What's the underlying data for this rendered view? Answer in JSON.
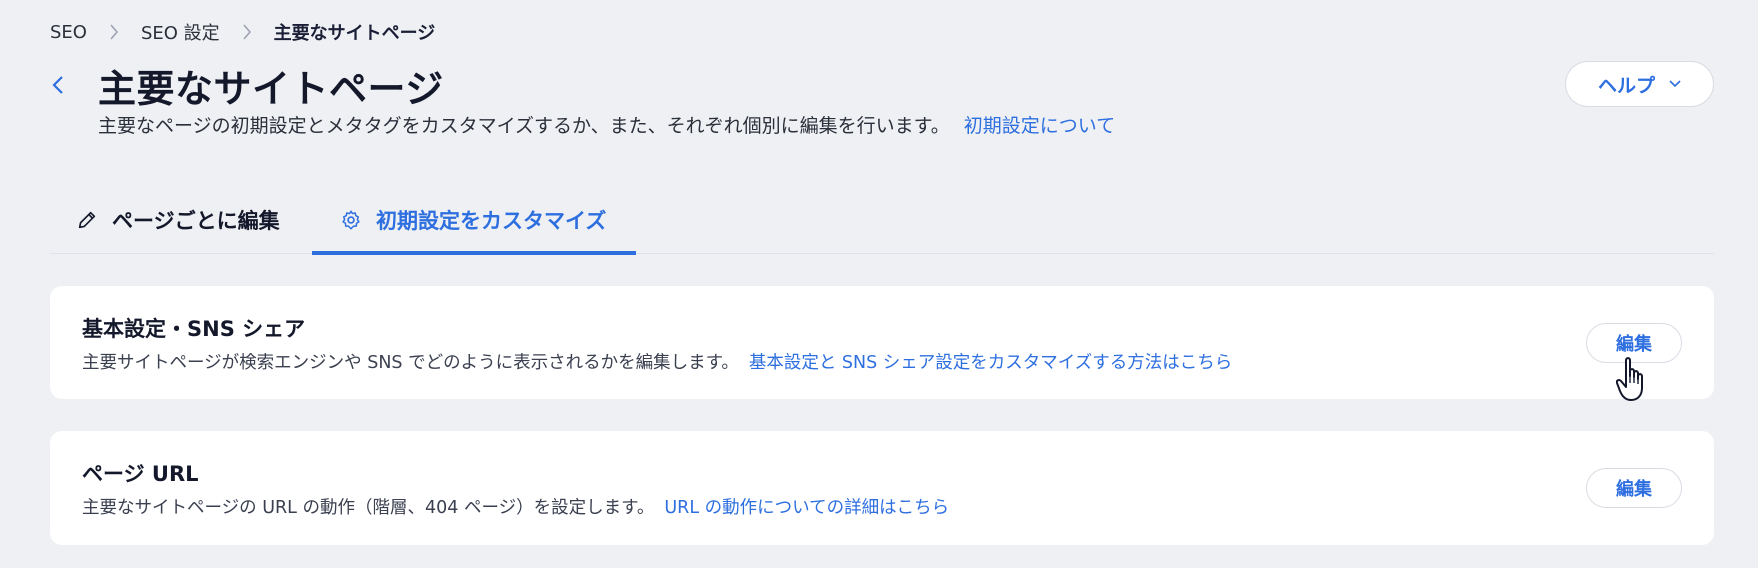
{
  "breadcrumb": {
    "items": [
      "SEO",
      "SEO 設定",
      "主要なサイトページ"
    ]
  },
  "header": {
    "title": "主要なサイトページ",
    "subtitle": "主要なページの初期設定とメタタグをカスタマイズするか、また、それぞれ個別に編集を行います。",
    "subtitle_link": "初期設定について",
    "help_label": "ヘルプ"
  },
  "tabs": [
    {
      "label": "ページごとに編集",
      "icon": "pencil-icon",
      "active": false
    },
    {
      "label": "初期設定をカスタマイズ",
      "icon": "gear-icon",
      "active": true
    }
  ],
  "cards": [
    {
      "title": "基本設定・SNS シェア",
      "description": "主要サイトページが検索エンジンや SNS でどのように表示されるかを編集します。",
      "link": "基本設定と SNS シェア設定をカスタマイズする方法はこちら",
      "button": "編集"
    },
    {
      "title": "ページ URL",
      "description": "主要なサイトページの URL の動作（階層、404 ページ）を設定します。",
      "link": "URL の動作についての詳細はこちら",
      "button": "編集"
    }
  ],
  "colors": {
    "accent": "#2e6fe0",
    "background": "#eef0f4",
    "card": "#ffffff"
  }
}
